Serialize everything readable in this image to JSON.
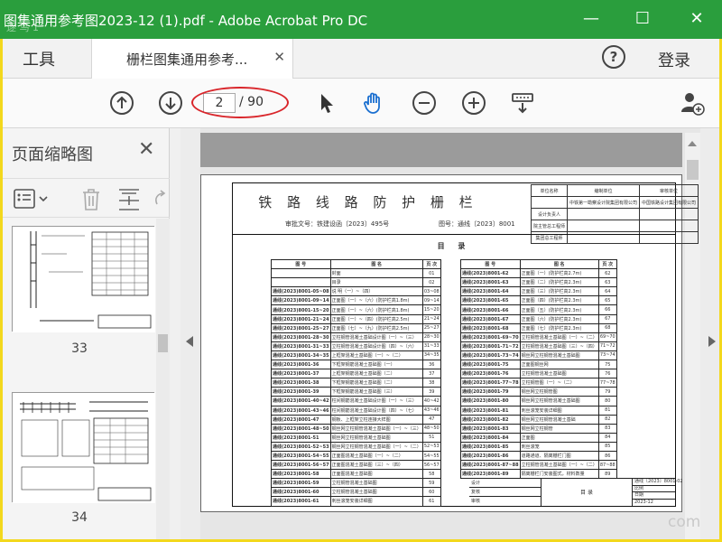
{
  "window": {
    "title": "图集通用参考图2023-12 (1).pdf - Adobe Acrobat Pro DC",
    "accent": "#2a9e3d",
    "frame_color": "#f3d81d"
  },
  "tabs": {
    "tools": "工具",
    "document": "栅栏图集通用参考...",
    "login": "登录"
  },
  "toolbar": {
    "current_page": "2",
    "total_pages": "/ 90"
  },
  "left_panel": {
    "title": "页面缩略图",
    "thumbnails": [
      {
        "page": "33"
      },
      {
        "page": "34"
      }
    ]
  },
  "document": {
    "title": "铁 路 线 路 防 护 栅 栏",
    "approval": "审批文号：铁建设函〔2023〕495号",
    "atlas_no": "图号：通线〔2023〕8001",
    "toc_heading": "目 录",
    "sign_block": [
      [
        "单位名称",
        "编制单位",
        "审核单位"
      ],
      [
        "",
        "中铁第一勘察设计院集团有限公司",
        "中国铁路设计集团有限公司"
      ],
      [
        "设计负责人",
        "",
        ""
      ],
      [
        "院主管总工程师",
        "",
        ""
      ],
      [
        "集团总工程师",
        "",
        ""
      ]
    ],
    "toc_header": [
      "图 号",
      "图 名",
      "页 次"
    ],
    "toc_left": [
      [
        "",
        "封面",
        "01"
      ],
      [
        "",
        "目录",
        "02"
      ],
      [
        "通线(2023)8001-05~08",
        "说 明（一）~（四）",
        "03~08"
      ],
      [
        "通线(2023)8001-09~14",
        "正面图（一）~（六）(防护栏高1.8m)",
        "09~14"
      ],
      [
        "通线(2023)8001-15~20",
        "正面图（一）~（六）(防护栏高1.8m)",
        "15~20"
      ],
      [
        "通线(2023)8001-21~24",
        "正面图（一）~（四）(防护栏高2.5m)",
        "21~24"
      ],
      [
        "通线(2023)8001-25~27",
        "正面图（七）~（九）(防护栏高2.5m)",
        "25~27"
      ],
      [
        "通线(2023)8001-28~30",
        "立柱钢管混凝土基础设计图（一）~（三）",
        "28~30"
      ],
      [
        "通线(2023)8001-31~33",
        "立柱钢管混凝土基础设计图（四）~（六）",
        "31~33"
      ],
      [
        "通线(2023)8001-34~35",
        "上框架混凝土基础图（一）~（二）",
        "34~35"
      ],
      [
        "通线(2023)8001-36",
        "下框架钢筋混凝土基础图（一）",
        "36"
      ],
      [
        "通线(2023)8001-37",
        "上框架钢筋混凝土基础图（二）",
        "37"
      ],
      [
        "通线(2023)8001-38",
        "下框架钢筋混凝土基础图（二）",
        "38"
      ],
      [
        "通线(2023)8001-39",
        "下框架钢筋混凝土基础图（三）",
        "39"
      ],
      [
        "通线(2023)8001-40~42",
        "柱间钢筋混凝土基础设计图（一）~（三）",
        "40~42"
      ],
      [
        "通线(2023)8001-43~46",
        "柱间钢筋混凝土基础设计图（四）~（七）",
        "43~46"
      ],
      [
        "通线(2023)8001-47",
        "钢板、上框架立柱连接大样图",
        "47"
      ],
      [
        "通线(2023)8001-48~50",
        "钢丝网立柱钢管混凝土基础图（一）~（三）",
        "48~50"
      ],
      [
        "通线(2023)8001-51",
        "钢丝网立柱钢管混凝土基础图",
        "51"
      ],
      [
        "通线(2023)8001-52~53",
        "钢丝网立柱钢管混凝土基础图（一）~（二）",
        "52~53"
      ],
      [
        "通线(2023)8001-54~55",
        "正面图混凝土基础图（一）~（二）",
        "54~55"
      ],
      [
        "通线(2023)8001-56~57",
        "正面图混凝土基础图（三）~（四）",
        "56~57"
      ],
      [
        "通线(2023)8001-58",
        "正面图混凝土基础图",
        "58"
      ],
      [
        "通线(2023)8001-59",
        "立柱钢管混凝土基础图",
        "59"
      ],
      [
        "通线(2023)8001-60",
        "立柱钢管混凝土基础图",
        "60"
      ],
      [
        "通线(2023)8001-61",
        "刺丝滚笼安装详细图",
        "61"
      ]
    ],
    "toc_right": [
      [
        "通线(2023)8001-62",
        "正面图（一）(防护栏高2.7m)",
        "62"
      ],
      [
        "通线(2023)8001-63",
        "正面图（二）(防护栏高2.3m)",
        "63"
      ],
      [
        "通线(2023)8001-64",
        "正面图（三）(防护栏高2.3m)",
        "64"
      ],
      [
        "通线(2023)8001-65",
        "正面图（四）(防护栏高2.3m)",
        "65"
      ],
      [
        "通线(2023)8001-66",
        "正面图（五）(防护栏高2.3m)",
        "66"
      ],
      [
        "通线(2023)8001-67",
        "正面图（六）(防护栏高2.3m)",
        "67"
      ],
      [
        "通线(2023)8001-68",
        "正面图（七）(防护栏高2.3m)",
        "68"
      ],
      [
        "通线(2023)8001-69~70",
        "立柱钢管混凝土基础图（一）~（二）",
        "69~70"
      ],
      [
        "通线(2023)8001-71~72",
        "立柱钢管混凝土基础图（三）~（四）",
        "71~72"
      ],
      [
        "通线(2023)8001-73~74",
        "钢丝网立柱钢管混凝土基础图",
        "73~74"
      ],
      [
        "通线(2023)8001-75",
        "正面图钢丝网",
        "75"
      ],
      [
        "通线(2023)8001-76",
        "立柱钢管混凝土基础图",
        "76"
      ],
      [
        "通线(2023)8001-77~78",
        "立柱钢管图（一）~（二）",
        "77~78"
      ],
      [
        "通线(2023)8001-79",
        "钢丝网立柱钢管图",
        "79"
      ],
      [
        "通线(2023)8001-80",
        "钢丝网立柱钢管混凝土基础图",
        "80"
      ],
      [
        "通线(2023)8001-81",
        "刺丝滚笼安装详细图",
        "81"
      ],
      [
        "通线(2023)8001-82",
        "钢丝网立柱钢管混凝土基础",
        "82"
      ],
      [
        "通线(2023)8001-83",
        "钢丝网立柱钢管",
        "83"
      ],
      [
        "通线(2023)8001-84",
        "正面图",
        "84"
      ],
      [
        "通线(2023)8001-85",
        "刺丝滚笼",
        "85"
      ],
      [
        "通线(2023)8001-86",
        "道路通道、隔离栅栏门图",
        "86"
      ],
      [
        "通线(2023)8001-87~88",
        "立柱钢管混凝土基础图（一）~（二）",
        "87~88"
      ],
      [
        "通线(2023)8001-89",
        "隔离栅栏门安装图式，材料数量",
        "89"
      ]
    ],
    "title_block": {
      "rows": [
        "设计",
        "复核",
        "审核"
      ],
      "center": "目 录",
      "right_rows": [
        "通线〔2023〕8001-02",
        "比例",
        "日期",
        "2023-12"
      ]
    }
  },
  "watermarks": {
    "top": "逐 鸟 1",
    "bottom": "com"
  }
}
